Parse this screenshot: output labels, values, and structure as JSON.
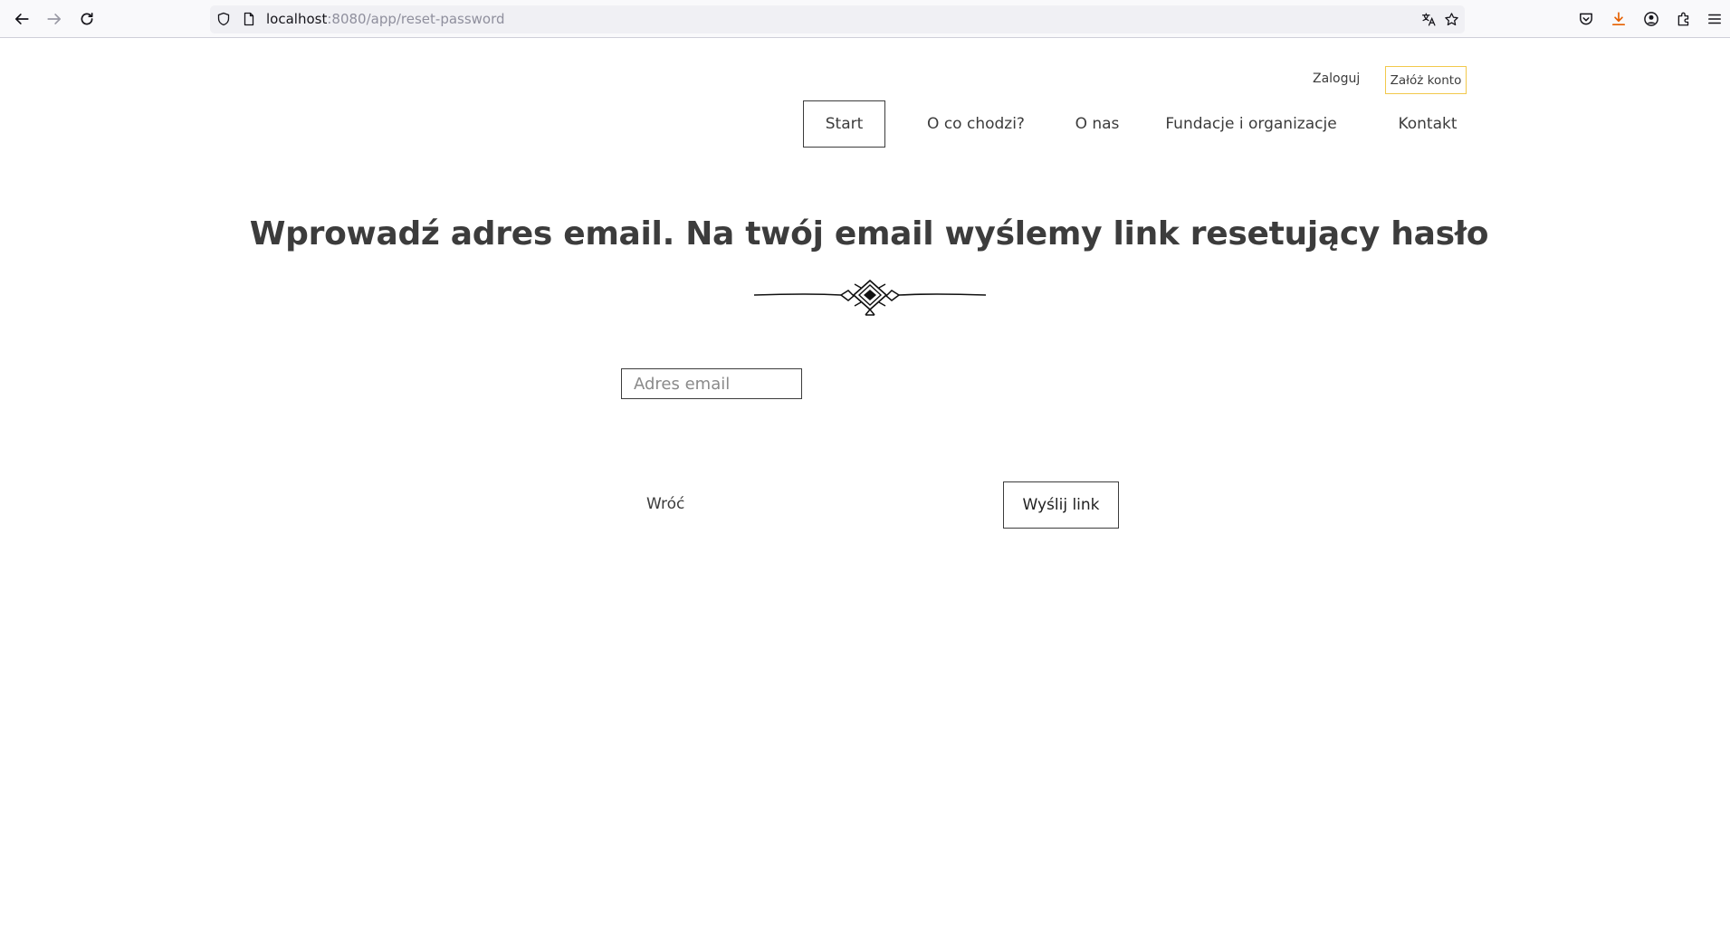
{
  "browser": {
    "url_host": "localhost",
    "url_path": ":8080/app/reset-password",
    "icons": {
      "back": "arrow-left-icon",
      "forward": "arrow-right-icon",
      "reload": "reload-icon",
      "shield": "shield-icon",
      "page": "page-icon",
      "translate": "translate-icon",
      "bookmark": "star-icon",
      "pocket": "pocket-icon",
      "downloads": "download-icon",
      "account": "account-icon",
      "extensions": "puzzle-icon",
      "menu": "hamburger-icon"
    },
    "download_accent": "#e66000"
  },
  "header": {
    "login_label": "Zaloguj",
    "register_label": "Załóż konto",
    "register_border_color": "#f2c94c"
  },
  "nav": {
    "items": [
      {
        "label": "Start",
        "active": true
      },
      {
        "label": "O co chodzi?",
        "active": false
      },
      {
        "label": "O nas",
        "active": false
      },
      {
        "label": "Fundacje i organizacje",
        "active": false
      },
      {
        "label": "Kontakt",
        "active": false
      }
    ]
  },
  "main": {
    "title": "Wprowadź adres email. Na twój email wyślemy link resetujący hasło",
    "email_placeholder": "Adres email",
    "email_value": "",
    "back_label": "Wróć",
    "submit_label": "Wyślij link"
  },
  "colors": {
    "text": "#3c3c3c",
    "background": "#ffffff"
  }
}
